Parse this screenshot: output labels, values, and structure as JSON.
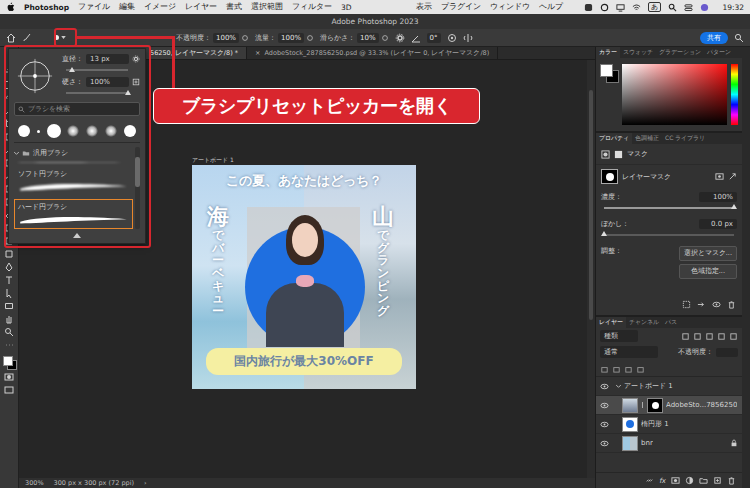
{
  "menubar": {
    "app": "Photoshop",
    "menus": [
      "ファイル",
      "編集",
      "イメージ",
      "レイヤー",
      "書式",
      "選択範囲",
      "フィルター",
      "3D"
    ],
    "right_menus": [
      "表示",
      "プラグイン",
      "ウィンドウ",
      "ヘルプ"
    ],
    "input_mode": "あ",
    "time": "19:32"
  },
  "window": {
    "title": "Adobe Photoshop 2023"
  },
  "options_bar": {
    "fields": [
      {
        "label": "不透明度：",
        "value": "100%"
      },
      {
        "label": "流量：",
        "value": "100%"
      },
      {
        "label": "滑らかさ：",
        "value": "10%"
      }
    ],
    "angle": "0°",
    "share": "共有"
  },
  "doc_tabs": [
    {
      "label": "56250, レイヤーマスク/8) *",
      "selected": true,
      "close": ""
    },
    {
      "label": "AdobeStock_287856250.psd @ 33.3% (レイヤー 0, レイヤーマスク/8)",
      "selected": false,
      "close": "×"
    }
  ],
  "brush_picker": {
    "diameter_label": "直径：",
    "diameter": "13 px",
    "diameter_level": 0.1,
    "hardness_label": "硬さ：",
    "hardness": "100%",
    "hardness_level": 1,
    "search_placeholder": "ブラシを検索",
    "tips": [
      {
        "kind": "hard",
        "selected": false
      },
      {
        "kind": "hard",
        "selected": false
      },
      {
        "kind": "hard",
        "selected": false
      },
      {
        "kind": "soft",
        "selected": false
      },
      {
        "kind": "soft",
        "selected": false
      },
      {
        "kind": "soft",
        "selected": false
      },
      {
        "kind": "hard",
        "selected": false
      }
    ],
    "folder": {
      "name": "汎用ブラシ",
      "expanded": true
    },
    "brushes": [
      {
        "name": "ソフト円ブラシ",
        "kind": "soft",
        "selected": false
      },
      {
        "name": "ハード円ブラシ",
        "kind": "hard",
        "selected": true
      }
    ]
  },
  "callout": "ブラシプリセットピッカーを開く",
  "artboard": {
    "label": "アートボード 1",
    "headline": "この夏、あなたはどっち？",
    "left_big": "海",
    "left_small": "でバーベキュー",
    "right_big": "山",
    "right_small": "でグランピング",
    "offer": "国内旅行が最大30%OFF"
  },
  "status_bar": {
    "zoom": "300%",
    "info": "300 px x 300 px (72 ppi)",
    "arrow": "›"
  },
  "color_panel": {
    "tabs": [
      {
        "label": "カラー",
        "selected": true
      },
      {
        "label": "スウォッチ",
        "selected": false
      },
      {
        "label": "グラデーション",
        "selected": false
      },
      {
        "label": "パターン",
        "selected": false
      }
    ],
    "foreground": "#ffffff",
    "background": "#000000"
  },
  "properties_panel": {
    "tabs": [
      {
        "label": "プロパティ",
        "selected": true
      },
      {
        "label": "色調補正",
        "selected": false
      },
      {
        "label": "CC ライブラリ",
        "selected": false
      }
    ],
    "section": "マスク",
    "mask_type": "レイヤーマスク",
    "density_label": "濃度：",
    "density": "100%",
    "density_level": 1,
    "feather_label": "ぼかし：",
    "feather": "0.0 px",
    "feather_level": 0,
    "adjust_label": "調整：",
    "buttons": [
      "選択とマスク...",
      "色域指定..."
    ]
  },
  "layers_panel": {
    "tabs": [
      {
        "label": "レイヤー",
        "selected": true
      },
      {
        "label": "チャンネル",
        "selected": false
      },
      {
        "label": "パス",
        "selected": false
      }
    ],
    "filter": "種類",
    "blend_mode": "通常",
    "opacity_label": "不透明度：",
    "layers": [
      {
        "name": "アートボード 1",
        "kind": "artboard",
        "expanded": true,
        "selected": false,
        "visible": true,
        "locked": false
      },
      {
        "name": "AdobeSto...7856250",
        "kind": "masked",
        "expanded": false,
        "selected": true,
        "visible": true,
        "locked": false
      },
      {
        "name": "楕円形 1",
        "kind": "shape",
        "expanded": false,
        "selected": false,
        "visible": true,
        "locked": false
      },
      {
        "name": "bnr",
        "kind": "image",
        "expanded": false,
        "selected": false,
        "visible": true,
        "locked": true
      }
    ],
    "footer_fx": "fx"
  }
}
